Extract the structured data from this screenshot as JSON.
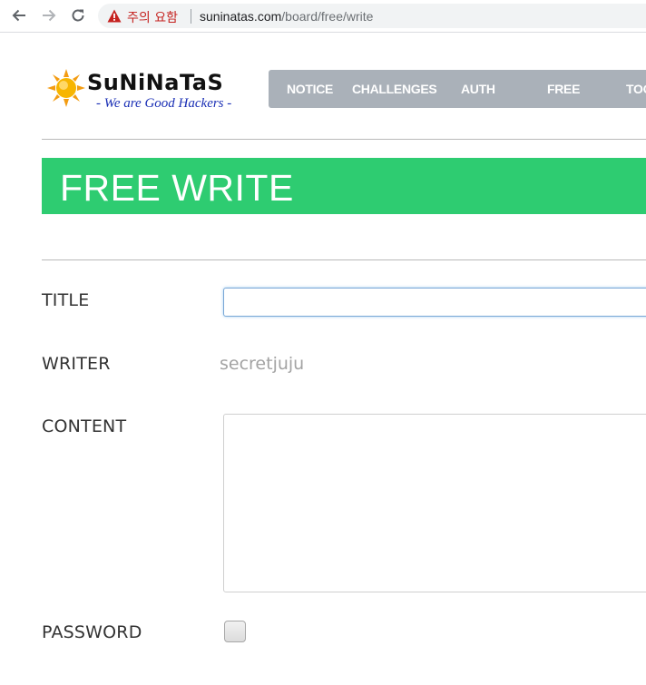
{
  "browser": {
    "warning_label": "주의 요함",
    "url_host": "suninatas.com",
    "url_path": "/board/free/write"
  },
  "logo": {
    "name": "SuNiNaTaS",
    "tagline": "- We are Good Hackers -"
  },
  "nav": {
    "items": [
      "NOTICE",
      "CHALLENGES",
      "AUTH",
      "FREE",
      "TOO"
    ]
  },
  "page": {
    "title": "FREE WRITE"
  },
  "form": {
    "title_label": "TITLE",
    "title_value": "",
    "writer_label": "WRITER",
    "writer_value": "secretjuju",
    "content_label": "CONTENT",
    "content_value": "",
    "password_label": "PASSWORD"
  },
  "colors": {
    "banner": "#2ecc71",
    "nav_bg": "#aab1b9",
    "warning": "#c5221f"
  }
}
